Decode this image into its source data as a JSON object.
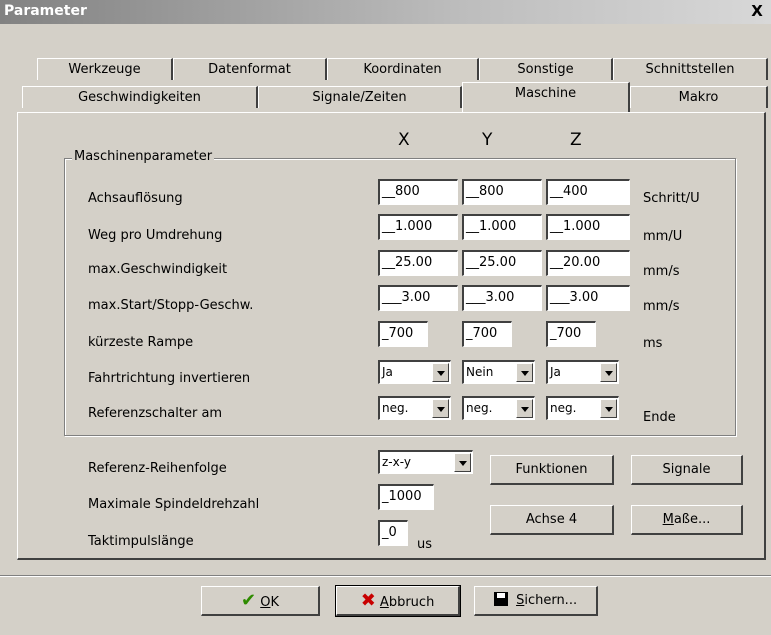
{
  "window": {
    "title": "Parameter",
    "close_label": "X"
  },
  "tabs_row1": [
    "Werkzeuge",
    "Datenformat",
    "Koordinaten",
    "Sonstige",
    "Schnittstellen"
  ],
  "tabs_row2": [
    "Geschwindigkeiten",
    "Signale/Zeiten",
    "Maschine",
    "Makro"
  ],
  "active_tab": "Maschine",
  "columns": [
    "X",
    "Y",
    "Z"
  ],
  "group_label": "Maschinenparameter",
  "rows": [
    {
      "label": "Achsauflösung",
      "values": [
        "__800",
        "__800",
        "__400"
      ],
      "unit": "Schritt/U"
    },
    {
      "label": "Weg pro Umdrehung",
      "values": [
        "__1.000",
        "__1.000",
        "__1.000"
      ],
      "unit": "mm/U"
    },
    {
      "label": "max.Geschwindigkeit",
      "values": [
        "__25.00",
        "__25.00",
        "__20.00"
      ],
      "unit": "mm/s"
    },
    {
      "label": "max.Start/Stopp-Geschw.",
      "values": [
        "___3.00",
        "___3.00",
        "___3.00"
      ],
      "unit": "mm/s"
    },
    {
      "label": "kürzeste Rampe",
      "values": [
        "_700",
        "_700",
        "_700"
      ],
      "unit": "ms"
    },
    {
      "label": "Fahrtrichtung invertieren",
      "values": [
        "Ja",
        "Nein",
        "Ja"
      ],
      "unit": ""
    },
    {
      "label": "Referenzschalter am",
      "values": [
        "neg.",
        "neg.",
        "neg."
      ],
      "unit": "Ende"
    }
  ],
  "bottom": {
    "ref_order_label": "Referenz-Reihenfolge",
    "ref_order_value": "z-x-y",
    "spindle_label": "Maximale Spindeldrehzahl",
    "spindle_value": "_1000",
    "pulse_label": "Taktimpulslänge",
    "pulse_value": "_0",
    "pulse_unit": "us"
  },
  "side_buttons": {
    "funktionen": "Funktionen",
    "signale": "Signale",
    "achse4": "Achse 4",
    "masse": "Maße..."
  },
  "footer_buttons": {
    "ok": "OK",
    "abbruch": "Abbruch",
    "sichern": "Sichern..."
  }
}
